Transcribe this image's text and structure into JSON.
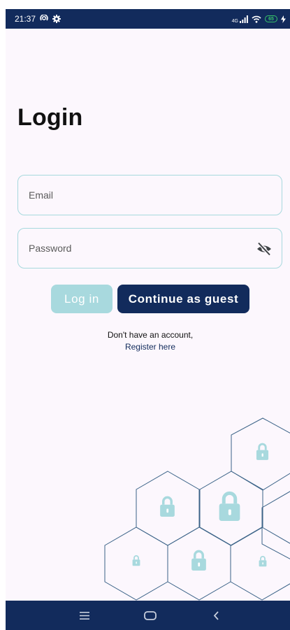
{
  "status_bar": {
    "time": "21:37",
    "network_label": "4G",
    "battery_level": "65",
    "icons": [
      "hotspot-icon",
      "settings-gear-icon",
      "signal-icon",
      "wifi-icon",
      "battery-icon",
      "charging-icon"
    ]
  },
  "login": {
    "title": "Login",
    "email_placeholder": "Email",
    "password_placeholder": "Password",
    "email_value": "",
    "password_value": "",
    "password_toggle_icon": "eye-slash-icon",
    "login_button": "Log in",
    "guest_button": "Continue as guest",
    "register_prompt": "Don't have an account,",
    "register_link": "Register here"
  },
  "decoration": {
    "icon": "padlock-icon",
    "shape": "hexagon"
  },
  "nav_bar": {
    "icons": [
      "menu-icon",
      "home-icon",
      "back-icon"
    ]
  },
  "colors": {
    "primary": "#122b5c",
    "accent": "#a8d9de",
    "screen_background": "#fcf7fd",
    "hex_outline": "#3a6287",
    "lock_fill": "#a8d9de"
  }
}
